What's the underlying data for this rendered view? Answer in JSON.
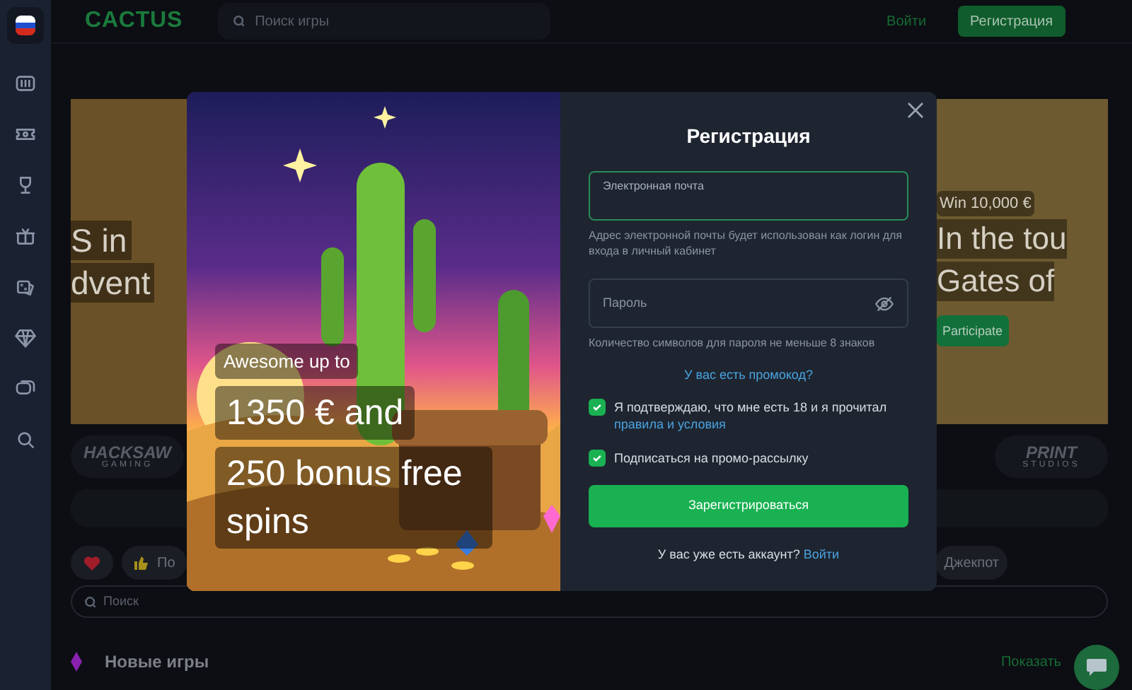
{
  "header": {
    "logo": "CACTUS",
    "search": {
      "placeholder": "Поиск игры"
    },
    "login": "Войти",
    "register": "Регистрация"
  },
  "banners": [
    {
      "lines": [
        "S in",
        "dvent"
      ]
    },
    {
      "tag": "Win 10,000 €",
      "lines": [
        "In the tou",
        "Gates of"
      ],
      "button": "Participate"
    }
  ],
  "providers": [
    {
      "name": "HACKSAW",
      "sub": "GAMING"
    },
    {
      "name": "PRINT",
      "sub": "STUDIOS"
    }
  ],
  "filters": [
    {
      "kind": "heart"
    },
    {
      "kind": "thumbs",
      "label": "По"
    },
    {
      "kind": "text",
      "label": "Джекпот"
    }
  ],
  "game_search": {
    "placeholder": "Поиск"
  },
  "section": {
    "title": "Новые игры",
    "link": "Показать"
  },
  "modal": {
    "promo": [
      {
        "kind": "small",
        "text": "Awesome up to"
      },
      {
        "kind": "large",
        "text": "1350 € and"
      },
      {
        "kind": "large",
        "text": "250 bonus free spins"
      }
    ],
    "title": "Регистрация",
    "email": {
      "label": "Электронная почта",
      "focused": true,
      "hint": "Адрес электронной почты будет использован как логин для входа в личный кабинет"
    },
    "password": {
      "placeholder": "Пароль",
      "hint": "Количество символов для пароля не меньше 8 знаков"
    },
    "promo_link": "У вас есть промокод?",
    "consents": [
      {
        "text": "Я подтверждаю, что мне есть 18 и я прочитал",
        "link": "правила и условия",
        "checked": true
      },
      {
        "text": "Подписаться на промо-рассылку",
        "checked": true
      }
    ],
    "submit": "Зарегистрироваться",
    "footer": {
      "text": "У вас уже есть аккаунт?",
      "link": "Войти"
    }
  }
}
